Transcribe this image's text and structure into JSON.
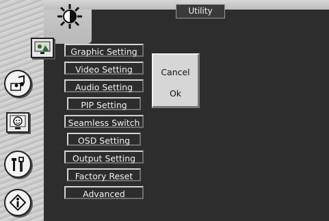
{
  "window": {
    "title": "Utility"
  },
  "menu": {
    "items": [
      {
        "label": "Graphic Setting"
      },
      {
        "label": "Video Setting"
      },
      {
        "label": "Audio Setting"
      },
      {
        "label": "PIP Setting"
      },
      {
        "label": "Seamless Switch"
      },
      {
        "label": "OSD Setting"
      },
      {
        "label": "Output Setting"
      },
      {
        "label": "Factory Reset"
      },
      {
        "label": "Advanced"
      }
    ]
  },
  "dialog": {
    "cancel_label": "Cancel",
    "ok_label": "Ok"
  },
  "icons": [
    "brightness-icon",
    "picture-icon",
    "audio-icon",
    "face-icon",
    "tools-icon",
    "info-icon"
  ]
}
